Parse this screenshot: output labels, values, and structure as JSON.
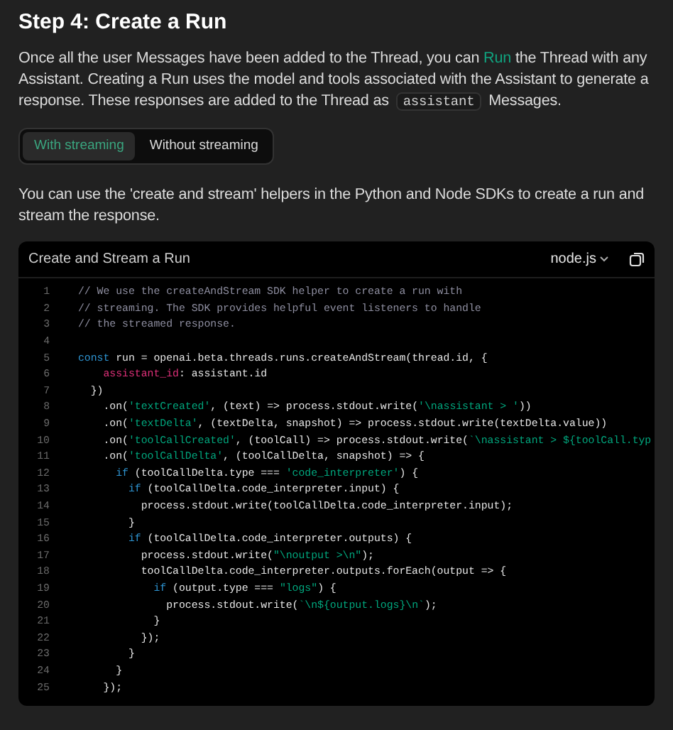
{
  "heading": "Step 4: Create a Run",
  "intro": [
    {
      "kind": "text",
      "text": "Once all the user Messages have been added to the Thread, you can "
    },
    {
      "kind": "link",
      "text": "Run"
    },
    {
      "kind": "text",
      "text": " the Thread with any Assistant. Creating a Run uses the model and tools associated with the Assistant to generate a response. These responses are added to the Thread as "
    },
    {
      "kind": "code",
      "text": "assistant"
    },
    {
      "kind": "text",
      "text": " Messages."
    }
  ],
  "tabs": [
    {
      "label": "With streaming",
      "selected": true
    },
    {
      "label": "Without streaming",
      "selected": false
    }
  ],
  "note": "You can use the 'create and stream' helpers in the Python and Node SDKs to create a run and stream the response.",
  "code_block": {
    "title": "Create and Stream a Run",
    "language": "node.js",
    "lines": [
      {
        "number": "1",
        "tokens": [
          {
            "kind": "comment",
            "text": "// We use the createAndStream SDK helper to create a run with"
          }
        ]
      },
      {
        "number": "2",
        "tokens": [
          {
            "kind": "comment",
            "text": "// streaming. The SDK provides helpful event listeners to handle"
          }
        ]
      },
      {
        "number": "3",
        "tokens": [
          {
            "kind": "comment",
            "text": "// the streamed response."
          }
        ]
      },
      {
        "number": "4"
      },
      {
        "number": "5",
        "tokens": [
          {
            "kind": "keyword",
            "text": "const"
          },
          {
            "kind": "plain",
            "text": " run = openai.beta.threads.runs.createAndStream(thread.id, {"
          }
        ]
      },
      {
        "number": "6",
        "tokens": [
          {
            "kind": "property",
            "text": "    assistant_id"
          },
          {
            "kind": "plain",
            "text": ": assistant.id"
          }
        ]
      },
      {
        "number": "7",
        "tokens": [
          {
            "kind": "plain",
            "text": "  })"
          }
        ]
      },
      {
        "number": "8",
        "tokens": [
          {
            "kind": "plain",
            "text": "    .on("
          },
          {
            "kind": "string",
            "text": "'textCreated'"
          },
          {
            "kind": "plain",
            "text": ", (text) => process.stdout.write("
          },
          {
            "kind": "string",
            "text": "'\\nassistant > '"
          },
          {
            "kind": "plain",
            "text": "))"
          }
        ]
      },
      {
        "number": "9",
        "tokens": [
          {
            "kind": "plain",
            "text": "    .on("
          },
          {
            "kind": "string",
            "text": "'textDelta'"
          },
          {
            "kind": "plain",
            "text": ", (textDelta, snapshot) => process.stdout.write(textDelta.value))"
          }
        ]
      },
      {
        "number": "10",
        "tokens": [
          {
            "kind": "plain",
            "text": "    .on("
          },
          {
            "kind": "string",
            "text": "'toolCallCreated'"
          },
          {
            "kind": "plain",
            "text": ", (toolCall) => process.stdout.write("
          },
          {
            "kind": "string",
            "text": "`\\nassistant > ${toolCall.typ"
          }
        ]
      },
      {
        "number": "11",
        "tokens": [
          {
            "kind": "plain",
            "text": "    .on("
          },
          {
            "kind": "string",
            "text": "'toolCallDelta'"
          },
          {
            "kind": "plain",
            "text": ", (toolCallDelta, snapshot) => {"
          }
        ]
      },
      {
        "number": "12",
        "tokens": [
          {
            "kind": "keyword",
            "text": "      if"
          },
          {
            "kind": "plain",
            "text": " (toolCallDelta.type === "
          },
          {
            "kind": "string",
            "text": "'code_interpreter'"
          },
          {
            "kind": "plain",
            "text": ") {"
          }
        ]
      },
      {
        "number": "13",
        "tokens": [
          {
            "kind": "keyword",
            "text": "        if"
          },
          {
            "kind": "plain",
            "text": " (toolCallDelta.code_interpreter.input) {"
          }
        ]
      },
      {
        "number": "14",
        "tokens": [
          {
            "kind": "plain",
            "text": "          process.stdout.write(toolCallDelta.code_interpreter.input);"
          }
        ]
      },
      {
        "number": "15",
        "tokens": [
          {
            "kind": "plain",
            "text": "        }"
          }
        ]
      },
      {
        "number": "16",
        "tokens": [
          {
            "kind": "keyword",
            "text": "        if"
          },
          {
            "kind": "plain",
            "text": " (toolCallDelta.code_interpreter.outputs) {"
          }
        ]
      },
      {
        "number": "17",
        "tokens": [
          {
            "kind": "plain",
            "text": "          process.stdout.write("
          },
          {
            "kind": "string",
            "text": "\"\\noutput >\\n\""
          },
          {
            "kind": "plain",
            "text": ");"
          }
        ]
      },
      {
        "number": "18",
        "tokens": [
          {
            "kind": "plain",
            "text": "          toolCallDelta.code_interpreter.outputs.forEach(output => {"
          }
        ]
      },
      {
        "number": "19",
        "tokens": [
          {
            "kind": "keyword",
            "text": "            if"
          },
          {
            "kind": "plain",
            "text": " (output.type === "
          },
          {
            "kind": "string",
            "text": "\"logs\""
          },
          {
            "kind": "plain",
            "text": ") {"
          }
        ]
      },
      {
        "number": "20",
        "tokens": [
          {
            "kind": "plain",
            "text": "              process.stdout.write("
          },
          {
            "kind": "string",
            "text": "`\\n${output.logs}\\n`"
          },
          {
            "kind": "plain",
            "text": ");"
          }
        ]
      },
      {
        "number": "21",
        "tokens": [
          {
            "kind": "plain",
            "text": "            }"
          }
        ]
      },
      {
        "number": "22",
        "tokens": [
          {
            "kind": "plain",
            "text": "          });"
          }
        ]
      },
      {
        "number": "23",
        "tokens": [
          {
            "kind": "plain",
            "text": "        }"
          }
        ]
      },
      {
        "number": "24",
        "tokens": [
          {
            "kind": "plain",
            "text": "      }"
          }
        ]
      },
      {
        "number": "25",
        "tokens": [
          {
            "kind": "plain",
            "text": "    });"
          }
        ]
      }
    ]
  }
}
